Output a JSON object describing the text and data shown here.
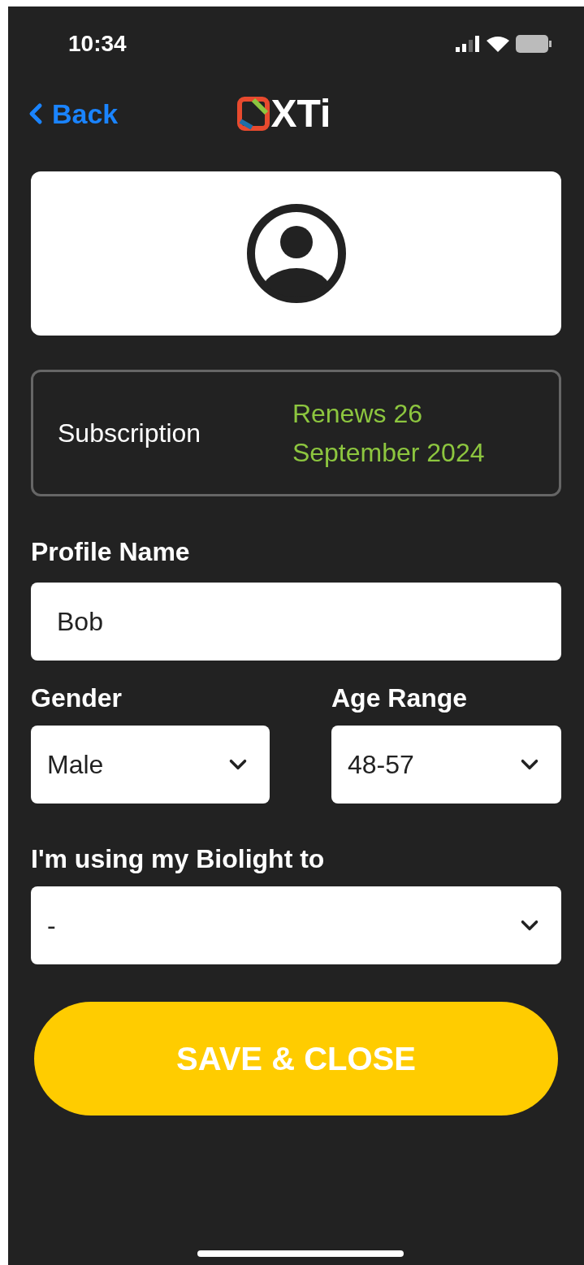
{
  "status_bar": {
    "time": "10:34"
  },
  "nav": {
    "back": "Back",
    "logo_text": "XTi"
  },
  "subscription": {
    "label": "Subscription",
    "value": "Renews 26 September 2024"
  },
  "profile_name": {
    "label": "Profile Name",
    "value": "Bob"
  },
  "gender": {
    "label": "Gender",
    "value": "Male"
  },
  "age_range": {
    "label": "Age Range",
    "value": "48-57"
  },
  "usage": {
    "label": "I'm using my Biolight to",
    "value": "-"
  },
  "save_button": "SAVE & CLOSE"
}
